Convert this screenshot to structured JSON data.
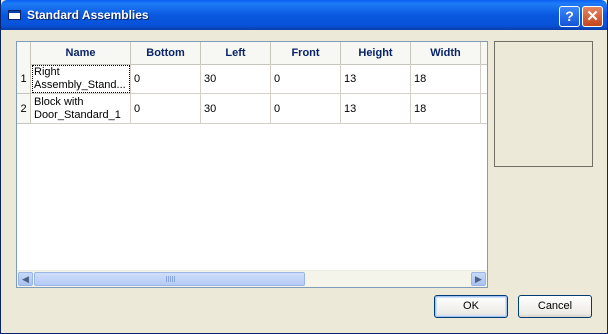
{
  "window": {
    "title": "Standard Assemblies"
  },
  "titlebar": {
    "help_label": "?",
    "close_label": "✕"
  },
  "grid": {
    "columns": [
      "Name",
      "Bottom",
      "Left",
      "Front",
      "Height",
      "Width"
    ],
    "rows": [
      {
        "index": "1",
        "name_line1": "Right",
        "name_line2": "Assembly_Stand...",
        "bottom": "0",
        "left": "30",
        "front": "0",
        "height": "13",
        "width": "18"
      },
      {
        "index": "2",
        "name_line1": "Block with",
        "name_line2": "Door_Standard_1",
        "bottom": "0",
        "left": "30",
        "front": "0",
        "height": "13",
        "width": "18"
      }
    ],
    "scroll_left_glyph": "◀",
    "scroll_right_glyph": "▶"
  },
  "buttons": {
    "ok": "OK",
    "cancel": "Cancel"
  }
}
